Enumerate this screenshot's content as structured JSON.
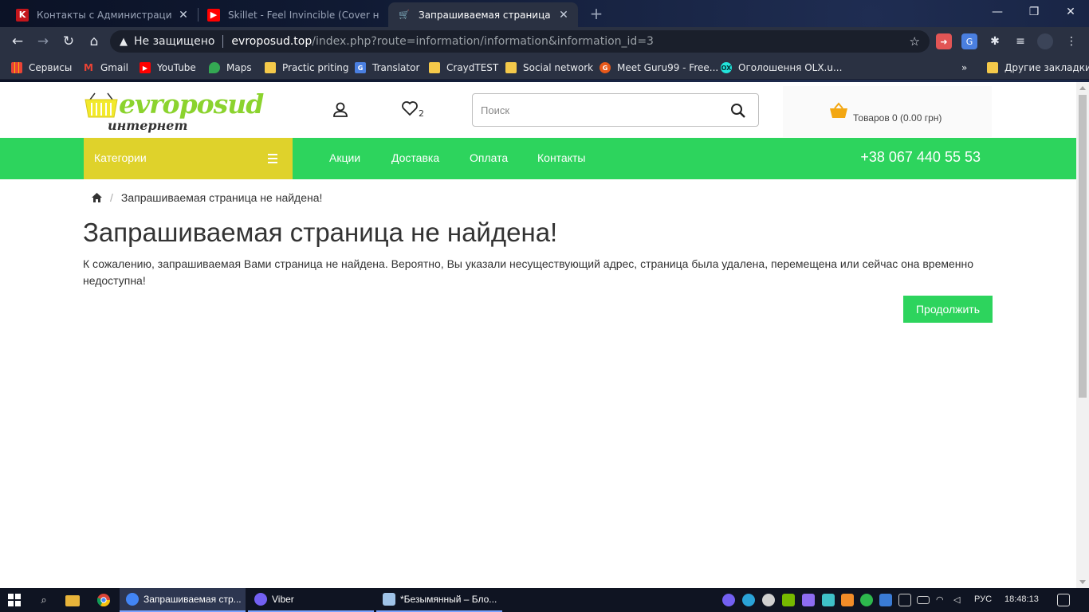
{
  "browser": {
    "tabs": [
      {
        "title": "Контакты с Администрацией са",
        "favicon": "k-favicon",
        "active": false
      },
      {
        "title": "Skillet - Feel Invincible (Cover на",
        "favicon": "youtube-favicon",
        "active": false
      },
      {
        "title": "Запрашиваемая страница не на",
        "favicon": "cart-favicon",
        "active": true
      }
    ],
    "address": {
      "security_label": "Не защищено",
      "host": "evroposud.top",
      "path": "/index.php?route=information/information&information_id=3"
    },
    "bookmarks": [
      {
        "label": "Сервисы",
        "icon": "apps-grid-icon"
      },
      {
        "label": "Gmail",
        "icon": "gmail-icon"
      },
      {
        "label": "YouTube",
        "icon": "youtube-icon"
      },
      {
        "label": "Maps",
        "icon": "maps-pin-icon"
      },
      {
        "label": "Practic priting",
        "icon": "folder-icon"
      },
      {
        "label": "Translator",
        "icon": "google-translate-icon"
      },
      {
        "label": "CraydTEST",
        "icon": "folder-icon"
      },
      {
        "label": "Social network",
        "icon": "folder-icon"
      },
      {
        "label": "Meet Guru99 - Free...",
        "icon": "guru99-icon"
      },
      {
        "label": "Оголошення OLX.u...",
        "icon": "olx-icon"
      }
    ],
    "other_bookmarks": "Другие закладки",
    "more_bookmarks": "»"
  },
  "site": {
    "logo": {
      "brand": "evroposud",
      "subtitle": "интернет магазин"
    },
    "wishlist_count": "2",
    "search": {
      "placeholder": "Поиск",
      "value": ""
    },
    "cart": {
      "label": "Товаров 0 (0.00 грн)"
    },
    "categories_label": "Категории",
    "menu": [
      "Акции",
      "Доставка",
      "Оплата",
      "Контакты"
    ],
    "phone": "+38 067 440 55 53",
    "breadcrumb": {
      "current": "Запрашиваемая страница не найдена!",
      "separator": "/"
    },
    "page_title": "Запрашиваемая страница не найдена!",
    "page_text": "К сожалению, запрашиваемая Вами страница не найдена. Вероятно, Вы указали несуществующий адрес, страница была удалена, перемещена или сейчас она временно недоступна!",
    "continue_label": "Продолжить",
    "colors": {
      "green": "#2dd45d",
      "yellow": "#dfd22b",
      "logo_green": "#8bd32e"
    }
  },
  "taskbar": {
    "apps": [
      {
        "label": "Запрашиваемая стр...",
        "icon": "chrome-icon",
        "active": true
      },
      {
        "label": "Viber",
        "icon": "viber-icon",
        "active": false
      },
      {
        "label": "*Безымянный – Бло...",
        "icon": "notepad-icon",
        "active": false
      }
    ],
    "language": "РУС",
    "time": "18:48:13"
  }
}
